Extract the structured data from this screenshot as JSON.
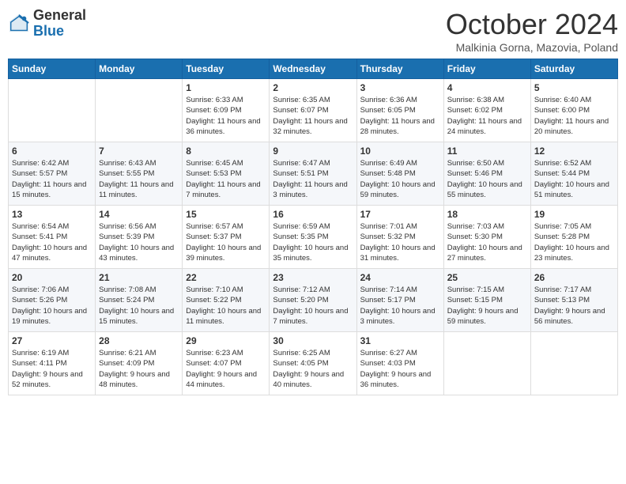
{
  "header": {
    "logo_general": "General",
    "logo_blue": "Blue",
    "month_title": "October 2024",
    "location": "Malkinia Gorna, Mazovia, Poland"
  },
  "days_of_week": [
    "Sunday",
    "Monday",
    "Tuesday",
    "Wednesday",
    "Thursday",
    "Friday",
    "Saturday"
  ],
  "weeks": [
    [
      {
        "day": "",
        "info": ""
      },
      {
        "day": "",
        "info": ""
      },
      {
        "day": "1",
        "info": "Sunrise: 6:33 AM\nSunset: 6:09 PM\nDaylight: 11 hours and 36 minutes."
      },
      {
        "day": "2",
        "info": "Sunrise: 6:35 AM\nSunset: 6:07 PM\nDaylight: 11 hours and 32 minutes."
      },
      {
        "day": "3",
        "info": "Sunrise: 6:36 AM\nSunset: 6:05 PM\nDaylight: 11 hours and 28 minutes."
      },
      {
        "day": "4",
        "info": "Sunrise: 6:38 AM\nSunset: 6:02 PM\nDaylight: 11 hours and 24 minutes."
      },
      {
        "day": "5",
        "info": "Sunrise: 6:40 AM\nSunset: 6:00 PM\nDaylight: 11 hours and 20 minutes."
      }
    ],
    [
      {
        "day": "6",
        "info": "Sunrise: 6:42 AM\nSunset: 5:57 PM\nDaylight: 11 hours and 15 minutes."
      },
      {
        "day": "7",
        "info": "Sunrise: 6:43 AM\nSunset: 5:55 PM\nDaylight: 11 hours and 11 minutes."
      },
      {
        "day": "8",
        "info": "Sunrise: 6:45 AM\nSunset: 5:53 PM\nDaylight: 11 hours and 7 minutes."
      },
      {
        "day": "9",
        "info": "Sunrise: 6:47 AM\nSunset: 5:51 PM\nDaylight: 11 hours and 3 minutes."
      },
      {
        "day": "10",
        "info": "Sunrise: 6:49 AM\nSunset: 5:48 PM\nDaylight: 10 hours and 59 minutes."
      },
      {
        "day": "11",
        "info": "Sunrise: 6:50 AM\nSunset: 5:46 PM\nDaylight: 10 hours and 55 minutes."
      },
      {
        "day": "12",
        "info": "Sunrise: 6:52 AM\nSunset: 5:44 PM\nDaylight: 10 hours and 51 minutes."
      }
    ],
    [
      {
        "day": "13",
        "info": "Sunrise: 6:54 AM\nSunset: 5:41 PM\nDaylight: 10 hours and 47 minutes."
      },
      {
        "day": "14",
        "info": "Sunrise: 6:56 AM\nSunset: 5:39 PM\nDaylight: 10 hours and 43 minutes."
      },
      {
        "day": "15",
        "info": "Sunrise: 6:57 AM\nSunset: 5:37 PM\nDaylight: 10 hours and 39 minutes."
      },
      {
        "day": "16",
        "info": "Sunrise: 6:59 AM\nSunset: 5:35 PM\nDaylight: 10 hours and 35 minutes."
      },
      {
        "day": "17",
        "info": "Sunrise: 7:01 AM\nSunset: 5:32 PM\nDaylight: 10 hours and 31 minutes."
      },
      {
        "day": "18",
        "info": "Sunrise: 7:03 AM\nSunset: 5:30 PM\nDaylight: 10 hours and 27 minutes."
      },
      {
        "day": "19",
        "info": "Sunrise: 7:05 AM\nSunset: 5:28 PM\nDaylight: 10 hours and 23 minutes."
      }
    ],
    [
      {
        "day": "20",
        "info": "Sunrise: 7:06 AM\nSunset: 5:26 PM\nDaylight: 10 hours and 19 minutes."
      },
      {
        "day": "21",
        "info": "Sunrise: 7:08 AM\nSunset: 5:24 PM\nDaylight: 10 hours and 15 minutes."
      },
      {
        "day": "22",
        "info": "Sunrise: 7:10 AM\nSunset: 5:22 PM\nDaylight: 10 hours and 11 minutes."
      },
      {
        "day": "23",
        "info": "Sunrise: 7:12 AM\nSunset: 5:20 PM\nDaylight: 10 hours and 7 minutes."
      },
      {
        "day": "24",
        "info": "Sunrise: 7:14 AM\nSunset: 5:17 PM\nDaylight: 10 hours and 3 minutes."
      },
      {
        "day": "25",
        "info": "Sunrise: 7:15 AM\nSunset: 5:15 PM\nDaylight: 9 hours and 59 minutes."
      },
      {
        "day": "26",
        "info": "Sunrise: 7:17 AM\nSunset: 5:13 PM\nDaylight: 9 hours and 56 minutes."
      }
    ],
    [
      {
        "day": "27",
        "info": "Sunrise: 6:19 AM\nSunset: 4:11 PM\nDaylight: 9 hours and 52 minutes."
      },
      {
        "day": "28",
        "info": "Sunrise: 6:21 AM\nSunset: 4:09 PM\nDaylight: 9 hours and 48 minutes."
      },
      {
        "day": "29",
        "info": "Sunrise: 6:23 AM\nSunset: 4:07 PM\nDaylight: 9 hours and 44 minutes."
      },
      {
        "day": "30",
        "info": "Sunrise: 6:25 AM\nSunset: 4:05 PM\nDaylight: 9 hours and 40 minutes."
      },
      {
        "day": "31",
        "info": "Sunrise: 6:27 AM\nSunset: 4:03 PM\nDaylight: 9 hours and 36 minutes."
      },
      {
        "day": "",
        "info": ""
      },
      {
        "day": "",
        "info": ""
      }
    ]
  ]
}
